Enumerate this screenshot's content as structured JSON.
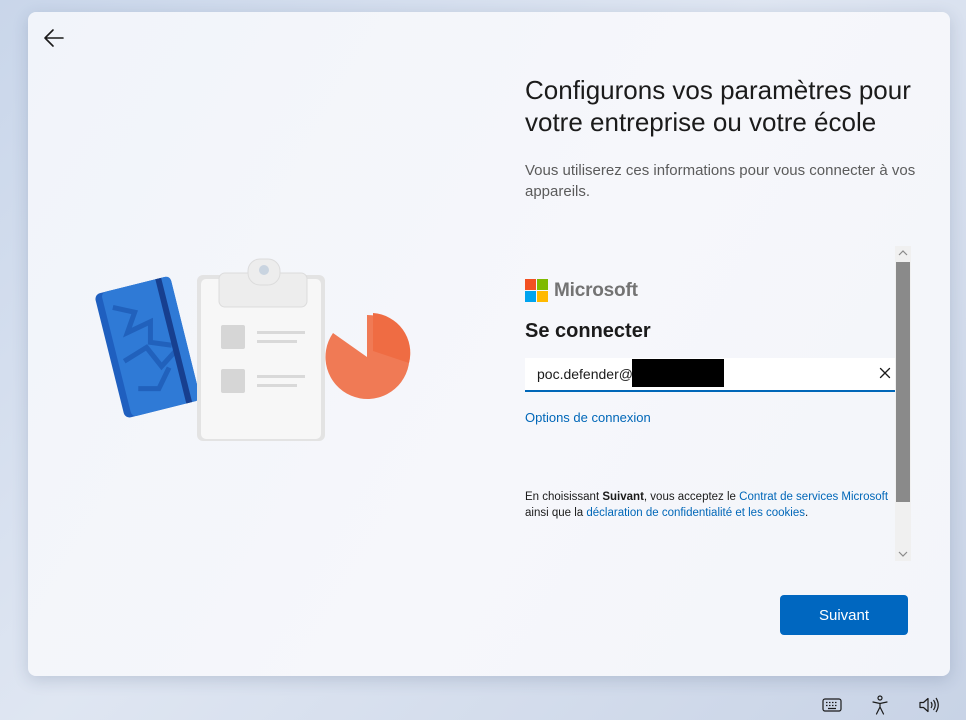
{
  "page": {
    "title": "Configurons vos paramètres pour votre entreprise ou votre école",
    "subtitle": "Vous utiliserez ces informations pour vous connecter à vos appareils."
  },
  "signin": {
    "brand": "Microsoft",
    "heading": "Se connecter",
    "email_value": "poc.defender@",
    "options_link": "Options de connexion",
    "terms": {
      "prefix": "En choisissant ",
      "bold": "Suivant",
      "middle": ", vous acceptez le ",
      "link1": "Contrat de services Microsoft",
      "line2_prefix": "ainsi que la ",
      "link2": "déclaration de confidentialité et les cookies",
      "suffix": "."
    }
  },
  "buttons": {
    "next": "Suivant"
  },
  "icons": {
    "back": "back-arrow-icon",
    "clear": "close-icon",
    "keyboard": "keyboard-icon",
    "accessibility": "accessibility-icon",
    "volume": "volume-icon"
  },
  "colors": {
    "accent": "#0067c0",
    "link": "#0067b8",
    "ms_red": "#f25022",
    "ms_green": "#7fba00",
    "ms_blue": "#00a4ef",
    "ms_yellow": "#ffb900"
  }
}
